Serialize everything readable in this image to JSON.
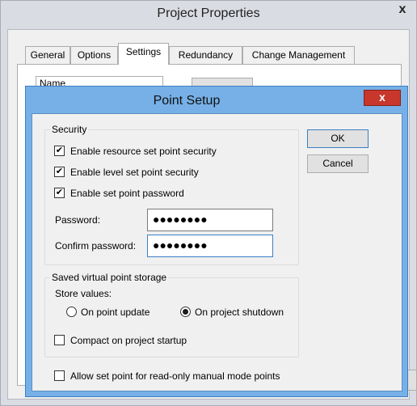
{
  "outer_window": {
    "title": "Project Properties",
    "close_glyph": "x",
    "tabs": [
      "General",
      "Options",
      "Settings",
      "Redundancy",
      "Change Management"
    ],
    "active_tab": "Settings",
    "name_field_label": "Name"
  },
  "dialog": {
    "title": "Point Setup",
    "close_glyph": "x",
    "security": {
      "legend": "Security",
      "checks": [
        {
          "label": "Enable resource set point security",
          "checked": true
        },
        {
          "label": "Enable level set point security",
          "checked": true
        },
        {
          "label": "Enable set point password",
          "checked": true
        }
      ],
      "password_label": "Password:",
      "password_value": "●●●●●●●●",
      "confirm_label": "Confirm password:",
      "confirm_value": "●●●●●●●●"
    },
    "storage": {
      "legend": "Saved virtual point storage",
      "store_label": "Store values:",
      "radio_update": "On point update",
      "radio_shutdown": "On project shutdown",
      "selected": "On project shutdown",
      "compact_label": "Compact on project startup",
      "compact_checked": false
    },
    "allow_label": "Allow set point for read-only manual mode points",
    "allow_checked": false,
    "ok_label": "OK",
    "cancel_label": "Cancel"
  },
  "check_glyph": "✔"
}
